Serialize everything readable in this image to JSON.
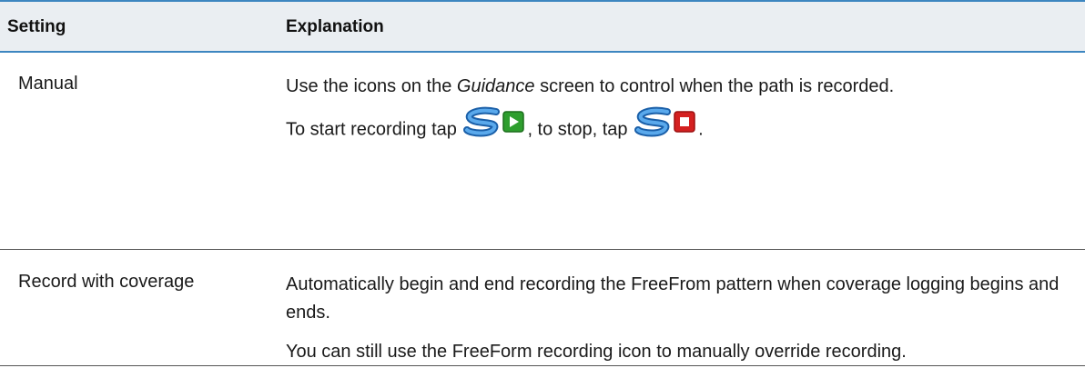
{
  "table": {
    "headers": {
      "setting": "Setting",
      "explanation": "Explanation"
    },
    "rows": [
      {
        "setting": "Manual",
        "line1_before": "Use the icons on the ",
        "line1_italic": "Guidance",
        "line1_after": " screen to control when the path is recorded.",
        "line2_before": "To start recording tap ",
        "line2_middle": ", to stop, tap ",
        "line2_after": ".",
        "icons": [
          "freeform-record-start-icon",
          "freeform-record-stop-icon"
        ]
      },
      {
        "setting": "Record with coverage",
        "para1": "Automatically begin and end recording the FreeFrom pattern when coverage logging begins and ends.",
        "para2": "You can still use the FreeForm recording icon to manually override recording."
      }
    ]
  },
  "colors": {
    "header_bg": "#eaeef2",
    "header_rule": "#3d86c0",
    "start_icon": "#2e9e2e",
    "stop_icon": "#d42020",
    "path_icon": "#2b7fd4"
  }
}
